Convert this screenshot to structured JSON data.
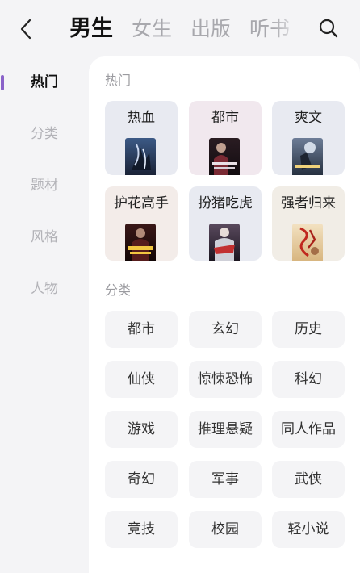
{
  "header": {
    "tabs": [
      {
        "label": "男生",
        "active": true
      },
      {
        "label": "女生",
        "active": false
      },
      {
        "label": "出版",
        "active": false
      },
      {
        "label": "听书",
        "active": false
      }
    ]
  },
  "sidebar": {
    "items": [
      {
        "label": "热门",
        "active": true
      },
      {
        "label": "分类",
        "active": false
      },
      {
        "label": "题材",
        "active": false
      },
      {
        "label": "风格",
        "active": false
      },
      {
        "label": "人物",
        "active": false
      }
    ]
  },
  "hot_section": {
    "title": "热门",
    "cards": [
      {
        "label": "热血",
        "bg": "#e8eaf1"
      },
      {
        "label": "都市",
        "bg": "#f1e8ee"
      },
      {
        "label": "爽文",
        "bg": "#e8eaf1"
      },
      {
        "label": "护花高手",
        "bg": "#f3ece9"
      },
      {
        "label": "扮猪吃虎",
        "bg": "#e8eaf1"
      },
      {
        "label": "强者归来",
        "bg": "#f1ede6"
      }
    ]
  },
  "category_section": {
    "title": "分类",
    "chips": [
      "都市",
      "玄幻",
      "历史",
      "仙侠",
      "惊悚恐怖",
      "科幻",
      "游戏",
      "推理悬疑",
      "同人作品",
      "奇幻",
      "军事",
      "武侠",
      "竞技",
      "校园",
      "轻小说"
    ]
  },
  "colors": {
    "accent": "#8a62c9",
    "panel_bg": "#ffffff",
    "page_bg": "#f4f4f6"
  },
  "icons": {
    "back": "chevron-left-icon",
    "search": "search-icon"
  }
}
